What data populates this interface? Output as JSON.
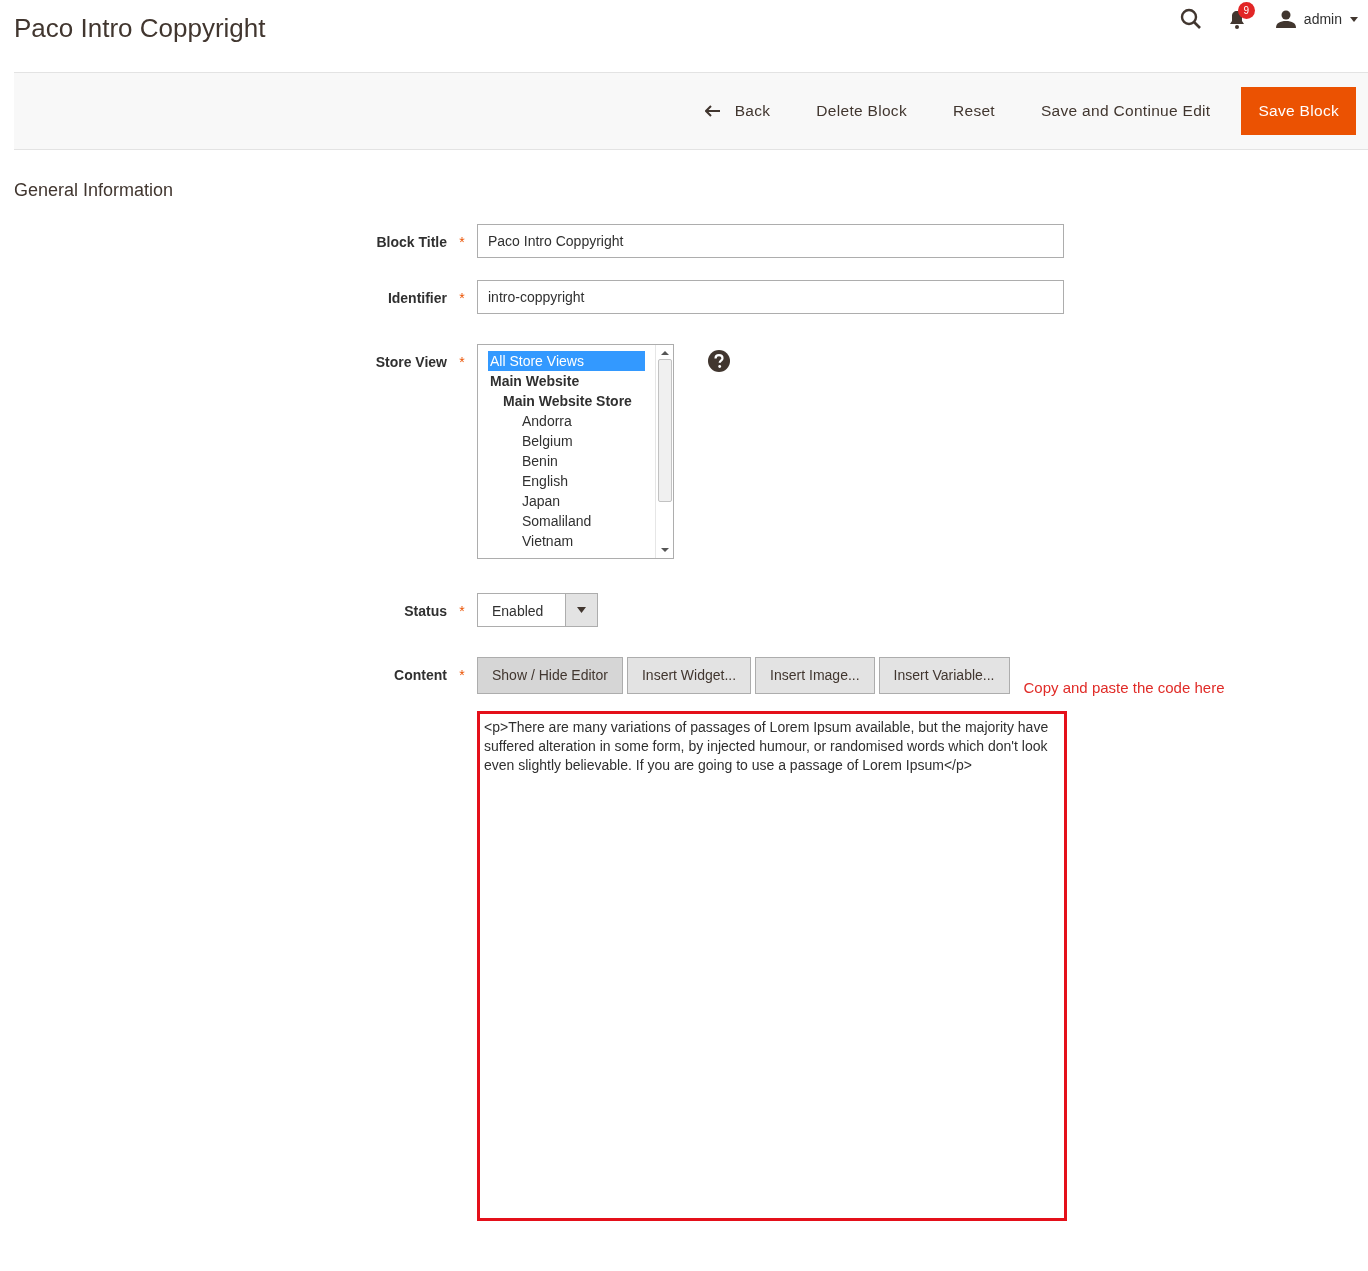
{
  "header": {
    "title": "Paco Intro Coppyright",
    "notifications": "9",
    "user": "admin"
  },
  "actions": [
    {
      "kind": "back",
      "label": "Back"
    },
    {
      "kind": "plain",
      "label": "Delete Block"
    },
    {
      "kind": "plain",
      "label": "Reset"
    },
    {
      "kind": "plain",
      "label": "Save and Continue Edit"
    },
    {
      "kind": "primary",
      "label": "Save Block"
    }
  ],
  "section_title": "General Information",
  "fields": [
    {
      "kind": "text",
      "label": "Block Title",
      "required_mark": "*",
      "value": "Paco Intro Coppyright"
    },
    {
      "kind": "text",
      "label": "Identifier",
      "required_mark": "*",
      "value": "intro-coppyright"
    },
    {
      "kind": "multiselect",
      "label": "Store View",
      "required_mark": "*",
      "help": true,
      "options": [
        {
          "label": "All Store Views",
          "selected": true
        },
        {
          "label": "Main Website",
          "selected": false,
          "children": [
            {
              "label": "Main Website Store",
              "selected": false,
              "children": [
                {
                  "label": "Andorra",
                  "selected": false
                },
                {
                  "label": "Belgium",
                  "selected": false
                },
                {
                  "label": "Benin",
                  "selected": false
                },
                {
                  "label": "English",
                  "selected": false
                },
                {
                  "label": "Japan",
                  "selected": false
                },
                {
                  "label": "Somaliland",
                  "selected": false
                },
                {
                  "label": "Vietnam",
                  "selected": false
                }
              ]
            }
          ]
        }
      ]
    },
    {
      "kind": "select",
      "label": "Status",
      "required_mark": "*",
      "value": "Enabled"
    },
    {
      "kind": "editor",
      "label": "Content",
      "required_mark": "*",
      "toolbar": [
        {
          "label": "Show / Hide Editor",
          "active": true
        },
        {
          "label": "Insert Widget...",
          "active": false
        },
        {
          "label": "Insert Image...",
          "active": false
        },
        {
          "label": "Insert Variable...",
          "active": false
        }
      ],
      "note": "Copy and paste the code here",
      "highlighted": true,
      "value": "<p>There are many variations of passages of Lorem Ipsum available, but the majority have suffered alteration in some form, by injected humour, or randomised words which don't look even slightly believable. If you are going to use a passage of Lorem Ipsum</p>"
    }
  ]
}
